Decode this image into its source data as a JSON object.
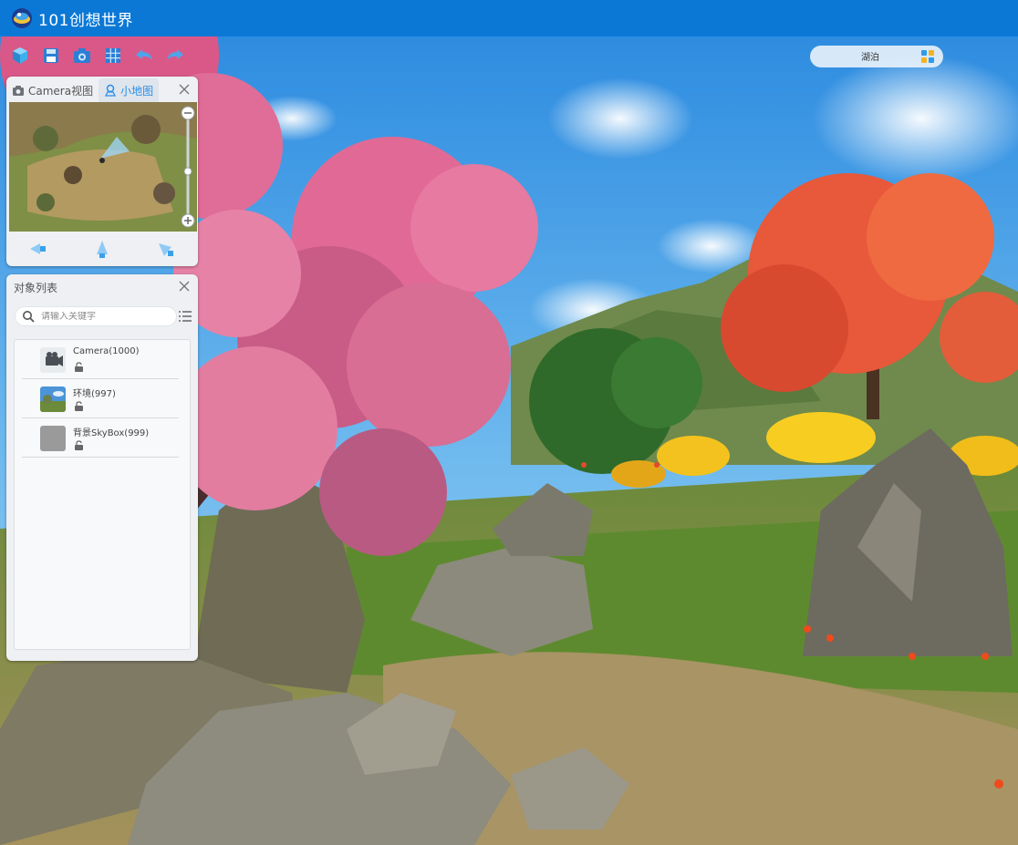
{
  "app": {
    "title": "101创想世界"
  },
  "toolbar": {
    "buttons": [
      {
        "name": "cube-icon"
      },
      {
        "name": "save-icon"
      },
      {
        "name": "camera-icon"
      },
      {
        "name": "grid-icon"
      },
      {
        "name": "undo-icon"
      },
      {
        "name": "redo-icon"
      }
    ]
  },
  "scene_selector": {
    "label": "湖泊",
    "icon": "scene-grid-icon"
  },
  "minimap_panel": {
    "tabs": [
      {
        "label": "Camera视图",
        "active": false,
        "icon": "camera-icon"
      },
      {
        "label": "小地图",
        "active": true,
        "icon": "map-pin-icon"
      }
    ],
    "zoom_minus": "−",
    "zoom_plus": "+"
  },
  "object_list": {
    "title": "对象列表",
    "search_placeholder": "请输入关键字",
    "items": [
      {
        "label": "Camera(1000)",
        "thumb": "camera-thumb"
      },
      {
        "label": "环境(997)",
        "thumb": "environment-thumb"
      },
      {
        "label": "背景SkyBox(999)",
        "thumb": "skybox-thumb"
      }
    ]
  },
  "colors": {
    "titlebar": "#0b78d6",
    "accent": "#2a8ee8",
    "panel": "#eef0f3"
  }
}
